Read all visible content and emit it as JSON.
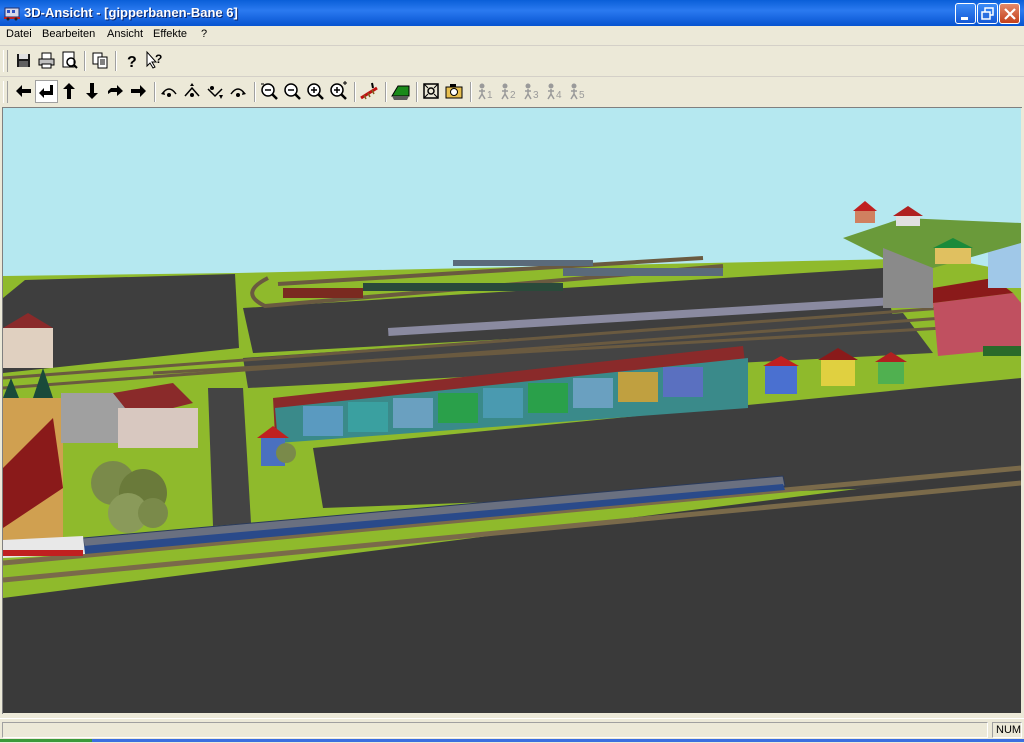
{
  "window": {
    "title": "3D-Ansicht - [gipperbanen-Bane 6]",
    "app_icon": "train-app-icon",
    "buttons": [
      "minimize",
      "restore",
      "close"
    ]
  },
  "menu": {
    "items": [
      {
        "label": "Datei",
        "accel": "D"
      },
      {
        "label": "Bearbeiten",
        "accel": "B"
      },
      {
        "label": "Ansicht",
        "accel": "A"
      },
      {
        "label": "Effekte",
        "accel": "E"
      },
      {
        "label": "?",
        "accel": "?"
      }
    ]
  },
  "toolbar1": {
    "buttons": [
      "save-icon",
      "print-icon",
      "print-preview-icon",
      "copy-icon",
      "help-icon",
      "context-help-icon"
    ]
  },
  "toolbar2": {
    "buttons": [
      "arrow-left-icon",
      "arrow-back-icon",
      "arrow-up-icon",
      "arrow-down-icon",
      "arrow-forward-icon",
      "arrow-right-icon",
      "view-rotate-left-icon",
      "view-tilt-up-icon",
      "view-tilt-down-icon",
      "view-rotate-right-icon",
      "zoom-out-icon",
      "zoom-minus-icon",
      "zoom-plus-icon",
      "zoom-in-icon",
      "track-icon",
      "terrain-icon",
      "fit-view-icon",
      "camera-icon"
    ],
    "camera_presets": [
      "1",
      "2",
      "3",
      "4",
      "5"
    ],
    "pressed_button": "arrow-back-icon"
  },
  "colors": {
    "sky": "#b5e8f0",
    "grass": "#8fba2c",
    "road": "#3e3e3e",
    "titlebar": "#0a5fd8",
    "chrome": "#ece9d8"
  },
  "statusbar": {
    "message": "",
    "num_indicator": "NUM"
  }
}
